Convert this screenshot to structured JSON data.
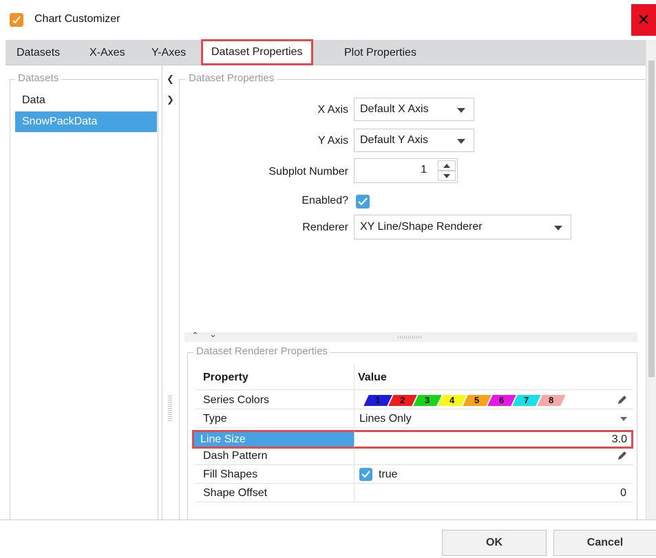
{
  "window": {
    "title": "Chart Customizer"
  },
  "tabs": [
    {
      "label": "Datasets"
    },
    {
      "label": "X-Axes"
    },
    {
      "label": "Y-Axes"
    },
    {
      "label": "Dataset Properties",
      "active": true
    },
    {
      "label": "Plot Properties"
    }
  ],
  "datasets_panel": {
    "legend": "Datasets",
    "items": [
      {
        "label": "Data",
        "selected": false
      },
      {
        "label": "SnowPackData",
        "selected": true
      }
    ]
  },
  "dataset_properties": {
    "legend": "Dataset Properties",
    "x_axis": {
      "label": "X Axis",
      "value": "Default X Axis"
    },
    "y_axis": {
      "label": "Y Axis",
      "value": "Default Y Axis"
    },
    "subplot": {
      "label": "Subplot Number",
      "value": "1"
    },
    "enabled": {
      "label": "Enabled?",
      "checked": true
    },
    "renderer": {
      "label": "Renderer",
      "value": "XY Line/Shape Renderer"
    }
  },
  "renderer_properties": {
    "legend": "Dataset Renderer Properties",
    "header": {
      "property": "Property",
      "value": "Value"
    },
    "rows": [
      {
        "name": "Series Colors"
      },
      {
        "name": "Type",
        "value": "Lines Only"
      },
      {
        "name": "Line Size",
        "value": "3.0"
      },
      {
        "name": "Dash Pattern",
        "value": ""
      },
      {
        "name": "Fill Shapes",
        "value": "true"
      },
      {
        "name": "Shape Offset",
        "value": "0"
      }
    ],
    "series_colors": [
      {
        "n": "1",
        "color": "#1d1dd8"
      },
      {
        "n": "2",
        "color": "#ee1c1c"
      },
      {
        "n": "3",
        "color": "#1ad31a"
      },
      {
        "n": "4",
        "color": "#f7f71a"
      },
      {
        "n": "5",
        "color": "#f6a21a"
      },
      {
        "n": "6",
        "color": "#e41ae4"
      },
      {
        "n": "7",
        "color": "#1ae0e6"
      },
      {
        "n": "8",
        "color": "#f4a9a9"
      }
    ]
  },
  "buttons": {
    "ok": "OK",
    "cancel": "Cancel"
  },
  "colors": {
    "accent": "#46a2e1",
    "highlight": "#e34a4f"
  }
}
